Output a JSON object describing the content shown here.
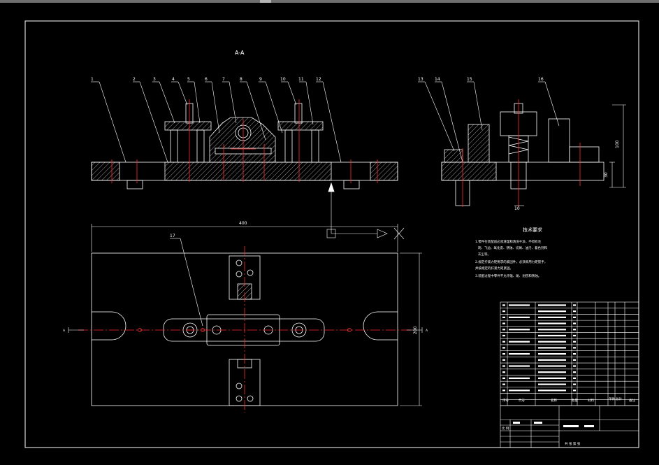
{
  "colors": {
    "background": "#000000",
    "line": "#ffffff",
    "hatch": "#ffffff",
    "center": "#ff0000",
    "dim": "#00ff00",
    "accent": "#ff3333"
  },
  "drawing": {
    "section_title": "A-A",
    "callouts": [
      "1",
      "2",
      "3",
      "4",
      "5",
      "6",
      "7",
      "8",
      "9",
      "10",
      "11",
      "12",
      "13",
      "14",
      "15",
      "16",
      "17"
    ],
    "dim_width": "400",
    "dim_depth": "200",
    "dim_height": "100",
    "dim_height_small": "30",
    "dim_small": "10",
    "section_mark": "A"
  },
  "tech_req": {
    "title": "技术要求",
    "lines": [
      "1.零件在装配前必须清理和清洗干净，不得有毛",
      "刺、飞边、氧化皮、锈蚀、切屑、油污、着色剂和",
      "灰尘等。",
      "2.规定拧紧力矩要求的紧固件，必须采用力矩扳手，",
      "并按规定的拧紧力矩紧固。",
      "3.装配过程中零件不允许磕、碰、划伤和锈蚀。"
    ]
  },
  "bom": {
    "header": [
      "序号",
      "代号",
      "名称",
      "数量",
      "材料",
      "单件",
      "总计",
      "备注"
    ]
  },
  "title_block": {
    "scale_label": "比 例",
    "sheet_label": "共  张  第  张"
  }
}
